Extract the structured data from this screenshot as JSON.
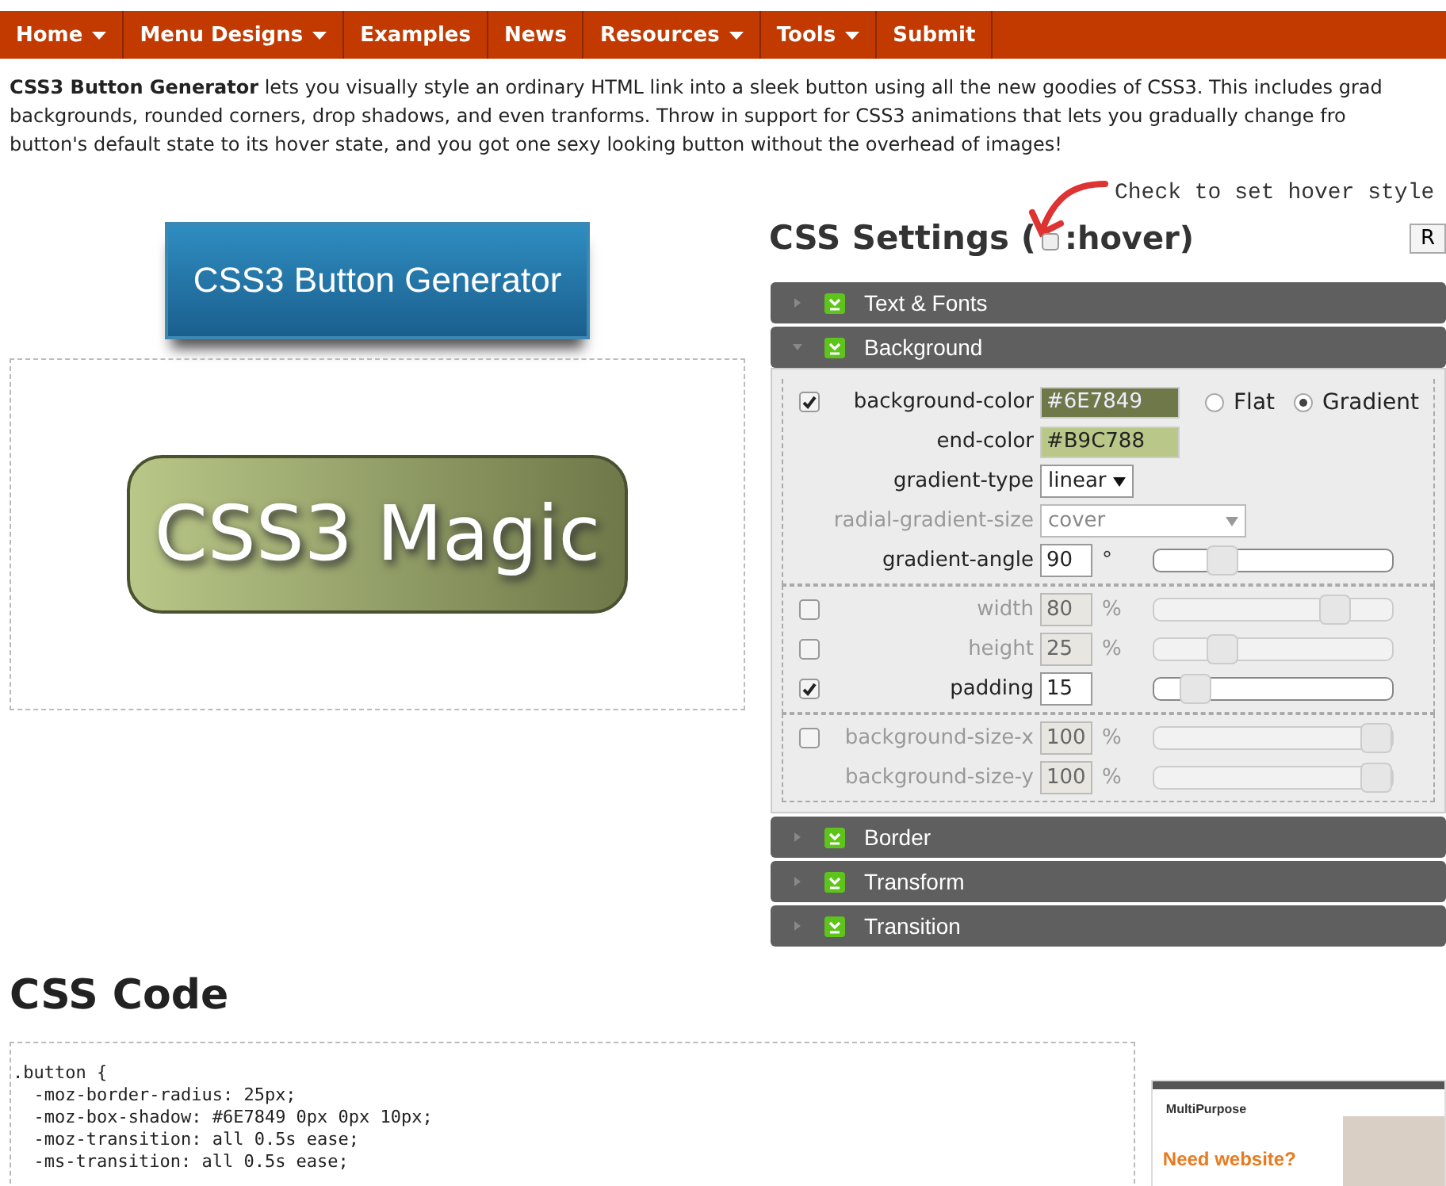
{
  "nav": [
    {
      "label": "Home",
      "dropdown": true
    },
    {
      "label": "Menu Designs",
      "dropdown": true
    },
    {
      "label": "Examples",
      "dropdown": false
    },
    {
      "label": "News",
      "dropdown": false
    },
    {
      "label": "Resources",
      "dropdown": true
    },
    {
      "label": "Tools",
      "dropdown": true
    },
    {
      "label": "Submit",
      "dropdown": false
    }
  ],
  "intro": "**CSS3 Button Generator** lets you visually style an ordinary HTML link into a sleek button using all the new goodies of CSS3. This includes grad\nbackgrounds, rounded corners, drop shadows, and even tranforms. Throw in support for CSS3 animations that lets you gradually change fro\nbutton's default state to its hover state, and you got one sexy looking button without the overhead of images!",
  "logo": {
    "text": "CSS3 Button Generator"
  },
  "preview": {
    "button_text": "CSS3 Magic"
  },
  "settings": {
    "annotation": "Check to set hover style",
    "heading": "CSS Settings (",
    "hover": {
      "label": ":hover)",
      "checked": false
    },
    "side_button": "R",
    "sections": [
      {
        "title": "Text & Fonts",
        "expanded": false
      },
      {
        "title": "Background",
        "expanded": true,
        "groups": [
          [
            {
              "label": "background-color",
              "kind": "color",
              "value": "#6E7849",
              "color": "#6e7849",
              "checked": true,
              "radios": [
                {
                  "label": "Flat",
                  "selected": false
                },
                {
                  "label": "Gradient",
                  "selected": true
                }
              ]
            },
            {
              "label": "end-color",
              "kind": "color",
              "value": "#B9C788",
              "color": "#b9c788"
            },
            {
              "label": "gradient-type",
              "kind": "select",
              "value": "linear",
              "disabled": false
            },
            {
              "label": "radial-gradient-size",
              "kind": "select",
              "value": "cover",
              "disabled": true
            },
            {
              "label": "gradient-angle",
              "kind": "number",
              "value": "90",
              "unit": "°",
              "level": 0.25,
              "disabled": false
            }
          ],
          [
            {
              "label": "width",
              "kind": "number",
              "value": "80",
              "unit": "%",
              "level": 0.8,
              "checked": false,
              "disabled": true
            },
            {
              "label": "height",
              "kind": "number",
              "value": "25",
              "unit": "%",
              "level": 0.25,
              "checked": false,
              "disabled": true
            },
            {
              "label": "padding",
              "kind": "number",
              "value": "15",
              "level": 0.12,
              "checked": true,
              "disabled": false
            }
          ],
          [
            {
              "label": "background-size-x",
              "kind": "number",
              "value": "100",
              "unit": "%",
              "level": 1,
              "checked": false,
              "disabled": true
            },
            {
              "label": "background-size-y",
              "kind": "number",
              "value": "100",
              "unit": "%",
              "level": 1,
              "disabled": true
            }
          ]
        ]
      },
      {
        "title": "Border",
        "expanded": false
      },
      {
        "title": "Transform",
        "expanded": false
      },
      {
        "title": "Transition",
        "expanded": false
      }
    ]
  },
  "code": {
    "heading": "CSS Code",
    "lines": [
      ".button {",
      "  -moz-border-radius: 25px;",
      "  -moz-box-shadow: #6E7849 0px 0px 10px;",
      "  -moz-transition: all 0.5s ease;",
      "  -ms-transition: all 0.5s ease;"
    ]
  },
  "ad": {
    "brand": "MultiPurpose",
    "headline": "Need website?"
  }
}
